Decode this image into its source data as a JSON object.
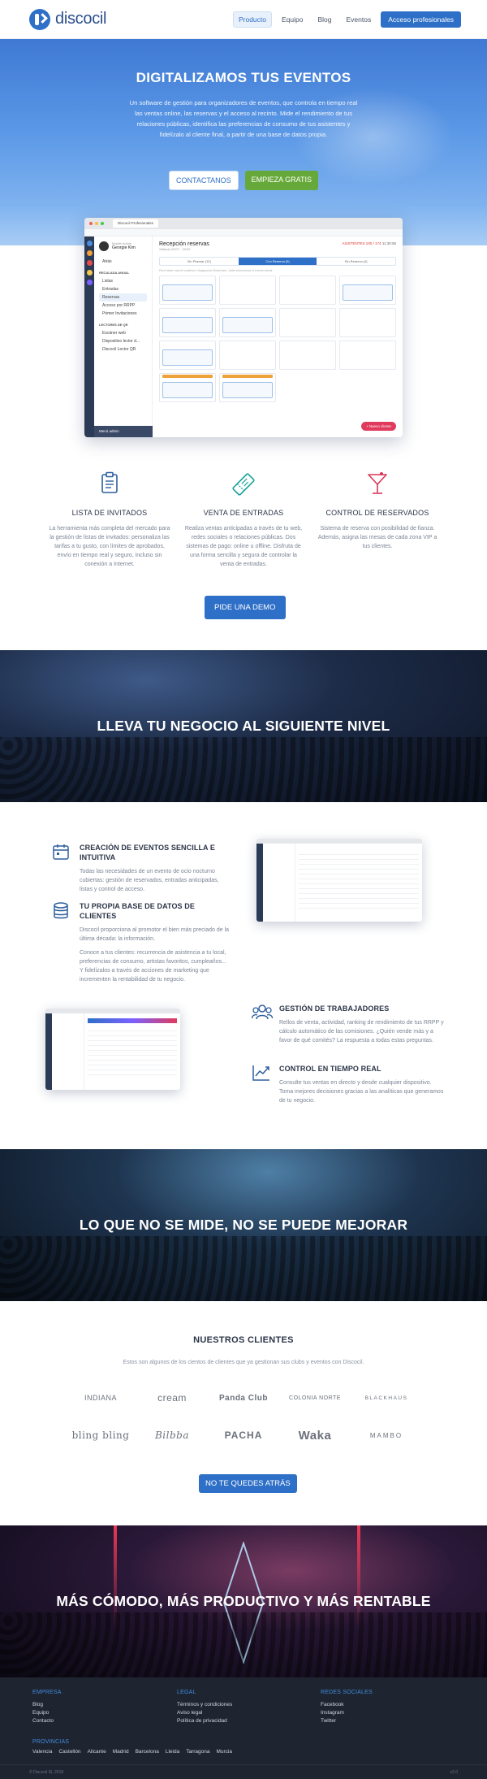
{
  "nav": {
    "brand": "discocil",
    "links": [
      "Producto",
      "Equipo",
      "Blog",
      "Eventos"
    ],
    "active": "Producto",
    "cta": "Acceso profesionales"
  },
  "hero": {
    "title": "DIGITALIZAMOS TUS EVENTOS",
    "text": "Un software de gestión para organizadores de eventos, que controla en tiempo real las ventas online, las reservas y el acceso al recinto. Mide el rendimiento de tus relaciones públicas, identifica las preferencias de consumo de tus asistentes y fidelízalo al cliente final, a partir de una base de datos propia.",
    "btn_contact": "CONTACTANOS",
    "btn_free": "EMPIEZA GRATIS"
  },
  "mockup": {
    "tab": "Discocil Profesionales",
    "user_name": "Georgie Kim",
    "user_role": "Mobile Admin",
    "menu_back": "Atrás",
    "section_1": "RECALADA ANUAL",
    "menu_items": [
      "Listas",
      "Entradas",
      "Reservas",
      "Acceso por RRPP",
      "Primer Invitaciones"
    ],
    "section_2": "LECTORES DE QR",
    "menu_items_2": [
      "Escáner web",
      "Dispositivo lector d...",
      "Discocil Lector QR"
    ],
    "title": "Recepción reservas",
    "date": "Sábado 20/07 - 23:00",
    "stats": "ASISTENTES 100 / 174",
    "stats_time": "11:30:06",
    "tabs": [
      "Sin Planear (12)",
      "Con Reserva (9)",
      "Sin Reserva (4)"
    ],
    "note": "Para hacer mas el cuaderno «Asignación Reservas», debe seleccionar el evento actual.",
    "footer_label": "Menú admin",
    "new_btn": "+ Nuevo cliente"
  },
  "features": [
    {
      "title": "LISTA DE INVITADOS",
      "text": "La herramienta más completa del mercado para la gestión de listas de invitados: personaliza las tarifas a tu gusto, con límites de aprobados, envío en tiempo real y seguro, incluso sin conexión a Internet.",
      "icon": "clipboard-icon"
    },
    {
      "title": "VENTA DE ENTRADAS",
      "text": "Realiza ventas anticipadas a través de tu web, redes sociales o relaciones públicas. Dos sistemas de pago: online u offline. Disfruta de una forma sencilla y segura de controlar la venta de entradas.",
      "icon": "ticket-icon"
    },
    {
      "title": "CONTROL DE RESERVADOS",
      "text": "Sistema de reserva con posibilidad de fianza. Además, asigna las mesas de cada zona VIP a tus clientes.",
      "icon": "cocktail-icon"
    }
  ],
  "demo_btn": "PIDE UNA DEMO",
  "banner_1": "LLEVA TU NEGOCIO AL SIGUIENTE NIVEL",
  "details": [
    {
      "title": "CREACIÓN DE EVENTOS SENCILLA E INTUITIVA",
      "text": "Todas las necesidades de un evento de ocio nocturno cubiertas: gestión de reservados, entradas anticipadas, listas y control de acceso.",
      "icon": "calendar-icon"
    },
    {
      "title": "TU PROPIA BASE DE DATOS DE CLIENTES",
      "text": "Discocil proporciona al promotor el bien más preciado de la última década: la información.",
      "text_2": "Conoce a tus clientes: recurrencia de asistencia a tu local, preferencias de consumo, artistas favoritos, cumpleaños... Y fidelízalos a través de acciones de marketing que incrementen la rentabilidad de tu negocio.",
      "icon": "database-icon"
    },
    {
      "title": "GESTIÓN DE TRABAJADORES",
      "text": "Rellos de venta, actividad, ranking de rendimiento de tus RRPP y cálculo automático de las comisiones. ¿Quién vende más y a favor de qué comités? La respuesta a todas estas preguntas.",
      "icon": "users-icon"
    },
    {
      "title": "CONTROL EN TIEMPO REAL",
      "text": "Consulte tus ventas en directo y desde cualquier dispositivo. Toma mejores decisiones gracias a las analíticas que generamos de tu negocio.",
      "icon": "chart-icon"
    }
  ],
  "banner_2": "LO QUE NO SE MIDE, NO SE PUEDE MEJORAR",
  "clients": {
    "title": "NUESTROS CLIENTES",
    "text": "Estos son algunos de los cientos de clientes que ya gestionan sus clubs y eventos con Discocil.",
    "logos": [
      "INDIANA",
      "cream",
      "Panda Club",
      "COLONIA NORTE",
      "BLACKHAUS",
      "bling bling",
      "Bilbba",
      "PACHA",
      "Waka",
      "MAMBO"
    ],
    "btn": "NO TE QUEDES ATRÁS"
  },
  "banner_3": "MÁS CÓMODO, MÁS PRODUCTIVO Y MÁS RENTABLE",
  "footer": {
    "col1_title": "EMPRESA",
    "col1": [
      "Blog",
      "Equipo",
      "Contacto"
    ],
    "col2_title": "LEGAL",
    "col2": [
      "Términos y condiciones",
      "Aviso legal",
      "Política de privacidad"
    ],
    "col3_title": "REDES SOCIALES",
    "col3": [
      "Facebook",
      "Instagram",
      "Twitter"
    ],
    "prov_title": "PROVINCIAS",
    "provinces": [
      "Valencia",
      "Castellón",
      "Alicante",
      "Madrid",
      "Barcelona",
      "Lleida",
      "Tarragona",
      "Murcia"
    ],
    "copyright": "© Discocil SL 2018",
    "version": "v2.0"
  },
  "colors": {
    "accent": "#2e6fc7",
    "green": "#67a83a",
    "footer_bg": "#1f2530"
  }
}
